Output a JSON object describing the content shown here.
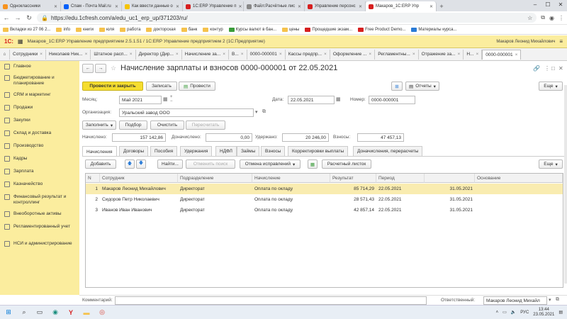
{
  "browser": {
    "tabs": [
      {
        "title": "Одноклассники",
        "color": "#f7931e"
      },
      {
        "title": "Спам - Почта Mail.ru",
        "color": "#005ff9"
      },
      {
        "title": "Как ввести данные о",
        "color": "#f5c400"
      },
      {
        "title": "1С:ERP Управление п",
        "color": "#d61f1f"
      },
      {
        "title": "Файл:Расчётные лис",
        "color": "#888888"
      },
      {
        "title": "Управление персонс",
        "color": "#d61f1f"
      },
      {
        "title": "Макаров_1С:ERP Упр",
        "color": "#d61f1f",
        "active": true
      }
    ],
    "url": "https://edu.1cfresh.com/a/edu_uc1_erp_up/371203/ru/",
    "bookmarks": [
      "Вкладки из 27 06 2...",
      "info",
      "книги",
      "юля",
      "работа",
      "докторская",
      "банк",
      "контур",
      "Курсы валют в бан...",
      "цены",
      "Прощедшие экзам...",
      "Free Product Demo...",
      "Материалы курса..."
    ]
  },
  "app": {
    "title": "Макаров_1С:ERP Управление предприятием 2.5.1.51 / 1С:ERP Управление предприятием 2   (1С:Предприятие)",
    "user": "Макаров Леонид Михайлович"
  },
  "window_tabs": [
    "Сотрудники",
    "Николаев Ник...",
    "Штатное расп...",
    "Директор (Дир...",
    "Начисление за...",
    "В...",
    "0000-000001",
    "Кассы предпр...",
    "Оформление ...",
    "Регламентны...",
    "Отражение за...",
    "Н...",
    "0000-000001"
  ],
  "sidebar": [
    {
      "label": "Главное"
    },
    {
      "label": "Бюджетирование и планирование"
    },
    {
      "label": "CRM и маркетинг"
    },
    {
      "label": "Продажи"
    },
    {
      "label": "Закупки"
    },
    {
      "label": "Склад и доставка"
    },
    {
      "label": "Производство"
    },
    {
      "label": "Кадры"
    },
    {
      "label": "Зарплата"
    },
    {
      "label": "Казначейство"
    },
    {
      "label": "Финансовый результат и контроллинг"
    },
    {
      "label": "Внеоборотные активы"
    },
    {
      "label": "Регламентированный учет"
    },
    {
      "label": "НСИ и администрирование"
    }
  ],
  "form": {
    "title": "Начисление зарплаты и взносов 0000-000001 от 22.05.2021",
    "btn_post_close": "Провести и закрыть",
    "btn_save": "Записать",
    "btn_post": "Провести",
    "btn_reports": "Отчеты",
    "btn_more": "Еще",
    "month_label": "Месяц:",
    "month_value": "Май 2021",
    "date_label": "Дата:",
    "date_value": "22.05.2021",
    "number_label": "Номер:",
    "number_value": "0000-000001",
    "org_label": "Организация:",
    "org_value": "Уральский завод ООО",
    "btn_fill": "Заполнить",
    "btn_select": "Подбор",
    "btn_clear": "Очистить",
    "btn_recalc": "Пересчитать",
    "accrued_label": "Начислено:",
    "accrued_value": "157 142,86",
    "extra_label": "Доначислено:",
    "extra_value": "0,00",
    "withheld_label": "Удержано:",
    "withheld_value": "20 246,00",
    "contrib_label": "Взносы:",
    "contrib_value": "47 457,13",
    "tabs": [
      "Начисления",
      "Договоры",
      "Пособия",
      "Удержания",
      "НДФЛ",
      "Займы",
      "Взносы",
      "Корректировки выплаты",
      "Доначисления, перерасчеты"
    ],
    "btn_add": "Добавить",
    "btn_find": "Найти...",
    "btn_cancel_search": "Отменить поиск",
    "btn_corrections": "Отмена исправлений",
    "btn_payslip": "Расчетный листок",
    "table_more": "Еще",
    "columns": [
      "N",
      "Сотрудник",
      "Подразделение",
      "Начисление",
      "Результат",
      "Период",
      "",
      "Основание"
    ],
    "rows": [
      {
        "n": "1",
        "employee": "Макаров Леонид Михайлович",
        "dept": "Директорат",
        "accrual": "Оплата по окладу",
        "result": "85 714,29",
        "from": "22.05.2021",
        "to": "31.05.2021"
      },
      {
        "n": "2",
        "employee": "Сидоров Петр Николаевич",
        "dept": "Директорат",
        "accrual": "Оплата по окладу",
        "result": "28 571,43",
        "from": "22.05.2021",
        "to": "31.05.2021"
      },
      {
        "n": "3",
        "employee": "Иванов Иван Иванович",
        "dept": "Директорат",
        "accrual": "Оплата по окладу",
        "result": "42 857,14",
        "from": "22.05.2021",
        "to": "31.05.2021"
      }
    ],
    "comment_label": "Комментарий:",
    "responsible_label": "Ответственный:",
    "responsible_value": "Макаров Леонид Михайл"
  },
  "taskbar": {
    "lang": "РУС",
    "time": "13:44",
    "date": "23.05.2021"
  }
}
